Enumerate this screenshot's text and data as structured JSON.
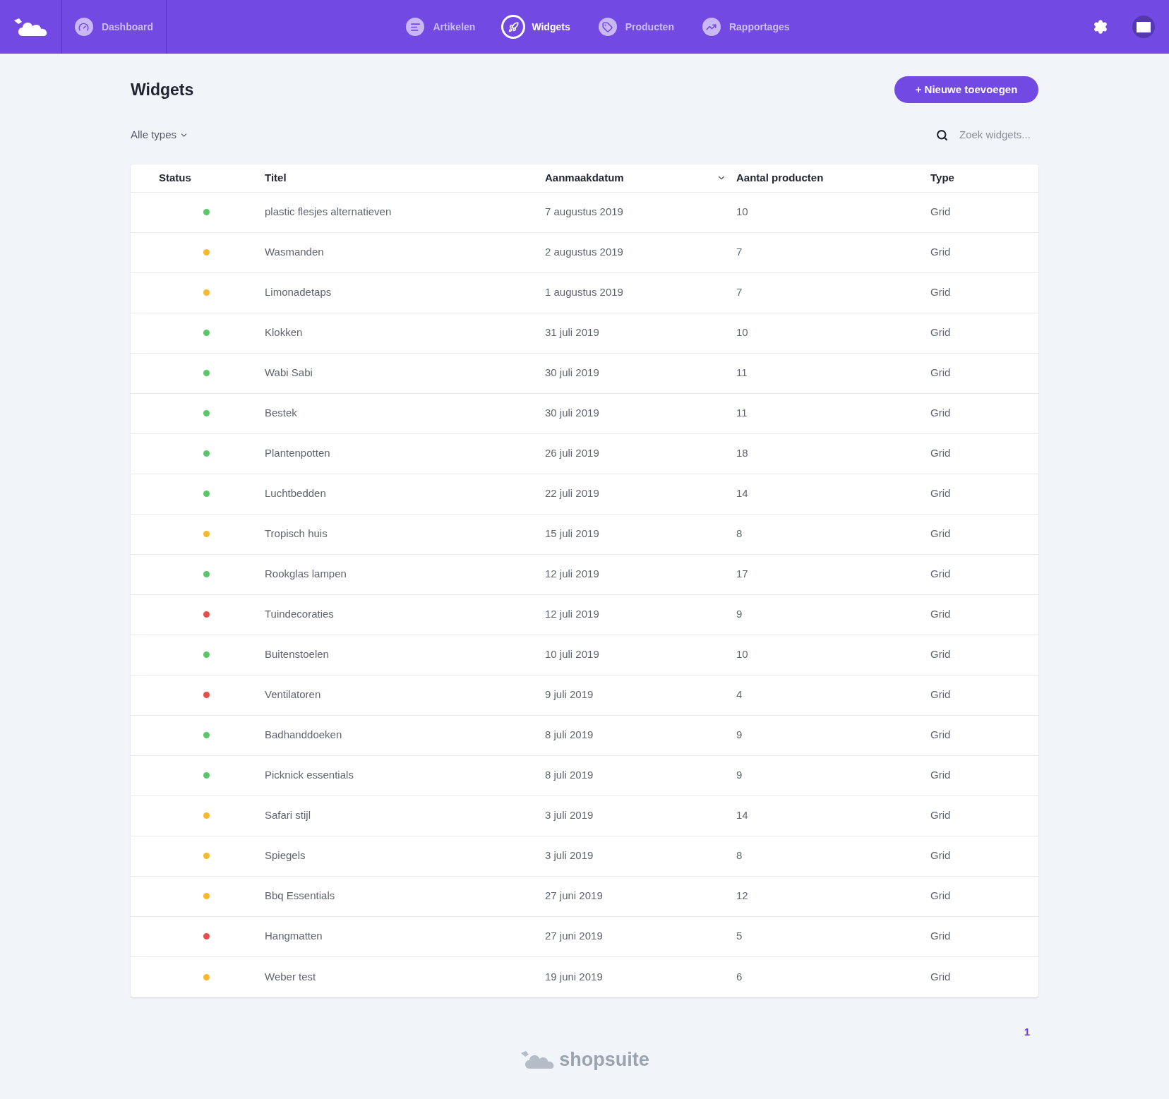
{
  "nav": {
    "items": [
      {
        "label": "Dashboard",
        "kind": "dashboard",
        "selected": false
      },
      {
        "label": "Artikelen",
        "kind": "articles",
        "selected": false
      },
      {
        "label": "Widgets",
        "kind": "widgets",
        "selected": true
      },
      {
        "label": "Producten",
        "kind": "products",
        "selected": false
      },
      {
        "label": "Rapportages",
        "kind": "reports",
        "selected": false
      }
    ]
  },
  "page": {
    "title": "Widgets",
    "add_button": "+ Nieuwe toevoegen",
    "filter": "Alle types",
    "search": {
      "placeholder": "Zoek widgets..."
    }
  },
  "table": {
    "columns": [
      "Status",
      "Titel",
      "Aanmaakdatum",
      "Aantal producten",
      "Type"
    ],
    "rows": [
      {
        "color": "#5cc46b",
        "title": "plastic flesjes alternatieven",
        "date": "7 augustus 2019",
        "count": "10",
        "type": "Grid"
      },
      {
        "color": "#f5b82e",
        "title": "Wasmanden",
        "date": "2 augustus 2019",
        "count": "7",
        "type": "Grid"
      },
      {
        "color": "#f5b82e",
        "title": "Limonadetaps",
        "date": "1 augustus 2019",
        "count": "7",
        "type": "Grid"
      },
      {
        "color": "#5cc46b",
        "title": "Klokken",
        "date": "31 juli 2019",
        "count": "10",
        "type": "Grid"
      },
      {
        "color": "#5cc46b",
        "title": "Wabi Sabi",
        "date": "30 juli 2019",
        "count": "11",
        "type": "Grid"
      },
      {
        "color": "#5cc46b",
        "title": "Bestek",
        "date": "30 juli 2019",
        "count": "11",
        "type": "Grid"
      },
      {
        "color": "#5cc46b",
        "title": "Plantenpotten",
        "date": "26 juli 2019",
        "count": "18",
        "type": "Grid"
      },
      {
        "color": "#5cc46b",
        "title": "Luchtbedden",
        "date": "22 juli 2019",
        "count": "14",
        "type": "Grid"
      },
      {
        "color": "#f5b82e",
        "title": "Tropisch huis",
        "date": "15 juli 2019",
        "count": "8",
        "type": "Grid"
      },
      {
        "color": "#5cc46b",
        "title": "Rookglas lampen",
        "date": "12 juli 2019",
        "count": "17",
        "type": "Grid"
      },
      {
        "color": "#e2504c",
        "title": "Tuindecoraties",
        "date": "12 juli 2019",
        "count": "9",
        "type": "Grid"
      },
      {
        "color": "#5cc46b",
        "title": "Buitenstoelen",
        "date": "10 juli 2019",
        "count": "10",
        "type": "Grid"
      },
      {
        "color": "#e2504c",
        "title": "Ventilatoren",
        "date": "9 juli 2019",
        "count": "4",
        "type": "Grid"
      },
      {
        "color": "#5cc46b",
        "title": "Badhanddoeken",
        "date": "8 juli 2019",
        "count": "9",
        "type": "Grid"
      },
      {
        "color": "#5cc46b",
        "title": "Picknick essentials",
        "date": "8 juli 2019",
        "count": "9",
        "type": "Grid"
      },
      {
        "color": "#f5b82e",
        "title": "Safari stijl",
        "date": "3 juli 2019",
        "count": "14",
        "type": "Grid"
      },
      {
        "color": "#f5b82e",
        "title": "Spiegels",
        "date": "3 juli 2019",
        "count": "8",
        "type": "Grid"
      },
      {
        "color": "#f5b82e",
        "title": "Bbq Essentials",
        "date": "27 juni 2019",
        "count": "12",
        "type": "Grid"
      },
      {
        "color": "#e2504c",
        "title": "Hangmatten",
        "date": "27 juni 2019",
        "count": "5",
        "type": "Grid"
      },
      {
        "color": "#f5b82e",
        "title": "Weber test",
        "date": "19 juni 2019",
        "count": "6",
        "type": "Grid"
      }
    ]
  },
  "pagination": {
    "pages": [
      {
        "label": "1",
        "selected": true
      }
    ]
  },
  "footer": {
    "brand": "shopsuite"
  }
}
